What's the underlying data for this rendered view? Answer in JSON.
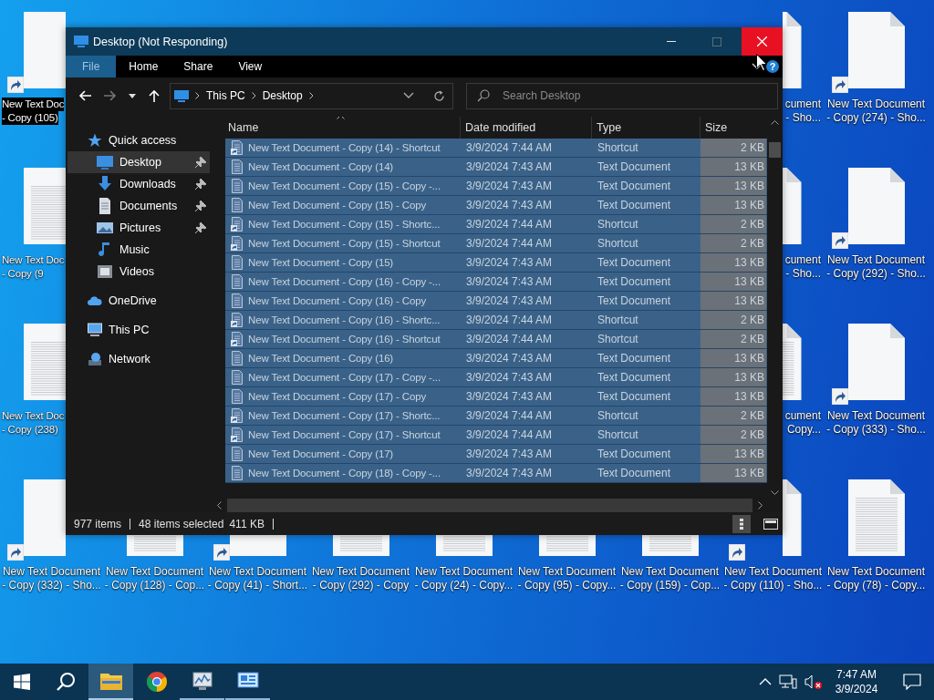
{
  "desktop": {
    "left_column": [
      {
        "kind": "shortcut",
        "selected": true,
        "label_lines": [
          "New Text Doc",
          "- Copy (105)"
        ]
      },
      {
        "kind": "document",
        "selected": false,
        "label_lines": [
          "New Text Doc",
          "- Copy (9"
        ]
      },
      {
        "kind": "document",
        "selected": false,
        "label_lines": [
          "New Text Doc",
          "- Copy (238)"
        ]
      }
    ],
    "partial_column": [
      {
        "kind": "shortcut",
        "selected": false,
        "label_lines": [
          "cument",
          "- Sho..."
        ]
      },
      {
        "kind": "shortcut",
        "selected": false,
        "label_lines": [
          "cument",
          "- Sho..."
        ]
      },
      {
        "kind": "document",
        "selected": false,
        "label_lines": [
          "cument",
          "Copy..."
        ]
      }
    ],
    "right_column": [
      {
        "kind": "shortcut",
        "selected": false,
        "label_lines": [
          "New Text Document",
          "- Copy (274) - Sho..."
        ]
      },
      {
        "kind": "shortcut",
        "selected": false,
        "label_lines": [
          "New Text Document",
          "- Copy (292) - Sho..."
        ]
      },
      {
        "kind": "shortcut",
        "selected": false,
        "label_lines": [
          "New Text Document",
          "- Copy (333) - Sho..."
        ]
      }
    ],
    "bottom_row": [
      {
        "kind": "shortcut",
        "selected": false,
        "label_lines": [
          "New Text Document",
          "- Copy (332) - Sho..."
        ]
      },
      {
        "kind": "document",
        "selected": false,
        "label_lines": [
          "New Text Document",
          "- Copy (128) - Cop..."
        ]
      },
      {
        "kind": "shortcut",
        "selected": false,
        "label_lines": [
          "New Text Document",
          "- Copy (41) - Short..."
        ]
      },
      {
        "kind": "document",
        "selected": false,
        "label_lines": [
          "New Text Document",
          "- Copy (292) - Copy"
        ]
      },
      {
        "kind": "document",
        "selected": false,
        "label_lines": [
          "New Text Document",
          "- Copy (24) - Copy..."
        ]
      },
      {
        "kind": "document",
        "selected": false,
        "label_lines": [
          "New Text Document",
          "- Copy (95) - Copy..."
        ]
      },
      {
        "kind": "document",
        "selected": false,
        "label_lines": [
          "New Text Document",
          "- Copy (159) - Cop..."
        ]
      },
      {
        "kind": "shortcut",
        "selected": false,
        "label_lines": [
          "New Text Document",
          "- Copy (110) - Sho..."
        ]
      },
      {
        "kind": "document",
        "selected": false,
        "label_lines": [
          "New Text Document",
          "- Copy (78) - Copy..."
        ]
      }
    ]
  },
  "window": {
    "title": "Desktop (Not Responding)",
    "ribbon_tabs": [
      {
        "label": "File",
        "selected": true
      },
      {
        "label": "Home",
        "selected": false
      },
      {
        "label": "Share",
        "selected": false
      },
      {
        "label": "View",
        "selected": false
      }
    ],
    "help": "?",
    "breadcrumbs": [
      "This PC",
      "Desktop"
    ],
    "search": {
      "placeholder": "Search Desktop"
    },
    "nav": [
      {
        "kind": "star",
        "label": "Quick access",
        "selected": false,
        "children": [
          {
            "kind": "desktop",
            "label": "Desktop",
            "pinned": true,
            "selected": true
          },
          {
            "kind": "downloads",
            "label": "Downloads",
            "pinned": true,
            "selected": false
          },
          {
            "kind": "documents",
            "label": "Documents",
            "pinned": true,
            "selected": false
          },
          {
            "kind": "pictures",
            "label": "Pictures",
            "pinned": true,
            "selected": false
          },
          {
            "kind": "music",
            "label": "Music",
            "pinned": false,
            "selected": false
          },
          {
            "kind": "videos",
            "label": "Videos",
            "pinned": false,
            "selected": false
          }
        ]
      },
      {
        "kind": "cloud",
        "label": "OneDrive",
        "selected": false
      },
      {
        "kind": "pc",
        "label": "This PC",
        "selected": false
      },
      {
        "kind": "network",
        "label": "Network",
        "selected": false
      }
    ],
    "columns": [
      {
        "label": "Name",
        "sorted": true
      },
      {
        "label": "Date modified",
        "sorted": false
      },
      {
        "label": "Type",
        "sorted": false
      },
      {
        "label": "Size",
        "sorted": false
      }
    ],
    "rows": [
      {
        "kind": "shortcut",
        "name": "New Text Document - Copy (14) - Shortcut",
        "date": "3/9/2024 7:44 AM",
        "type": "Shortcut",
        "size": "2 KB",
        "selected": true
      },
      {
        "kind": "document",
        "name": "New Text Document - Copy (14)",
        "date": "3/9/2024 7:43 AM",
        "type": "Text Document",
        "size": "13 KB",
        "selected": true
      },
      {
        "kind": "document",
        "name": "New Text Document - Copy (15) - Copy -...",
        "date": "3/9/2024 7:43 AM",
        "type": "Text Document",
        "size": "13 KB",
        "selected": true
      },
      {
        "kind": "document",
        "name": "New Text Document - Copy (15) - Copy",
        "date": "3/9/2024 7:43 AM",
        "type": "Text Document",
        "size": "13 KB",
        "selected": true
      },
      {
        "kind": "shortcut",
        "name": "New Text Document - Copy (15) - Shortc...",
        "date": "3/9/2024 7:44 AM",
        "type": "Shortcut",
        "size": "2 KB",
        "selected": true
      },
      {
        "kind": "shortcut",
        "name": "New Text Document - Copy (15) - Shortcut",
        "date": "3/9/2024 7:44 AM",
        "type": "Shortcut",
        "size": "2 KB",
        "selected": true
      },
      {
        "kind": "document",
        "name": "New Text Document - Copy (15)",
        "date": "3/9/2024 7:43 AM",
        "type": "Text Document",
        "size": "13 KB",
        "selected": true
      },
      {
        "kind": "document",
        "name": "New Text Document - Copy (16) - Copy -...",
        "date": "3/9/2024 7:43 AM",
        "type": "Text Document",
        "size": "13 KB",
        "selected": true
      },
      {
        "kind": "document",
        "name": "New Text Document - Copy (16) - Copy",
        "date": "3/9/2024 7:43 AM",
        "type": "Text Document",
        "size": "13 KB",
        "selected": true
      },
      {
        "kind": "shortcut",
        "name": "New Text Document - Copy (16) - Shortc...",
        "date": "3/9/2024 7:44 AM",
        "type": "Shortcut",
        "size": "2 KB",
        "selected": true
      },
      {
        "kind": "shortcut",
        "name": "New Text Document - Copy (16) - Shortcut",
        "date": "3/9/2024 7:44 AM",
        "type": "Shortcut",
        "size": "2 KB",
        "selected": true
      },
      {
        "kind": "document",
        "name": "New Text Document - Copy (16)",
        "date": "3/9/2024 7:43 AM",
        "type": "Text Document",
        "size": "13 KB",
        "selected": true
      },
      {
        "kind": "document",
        "name": "New Text Document - Copy (17) - Copy -...",
        "date": "3/9/2024 7:43 AM",
        "type": "Text Document",
        "size": "13 KB",
        "selected": true
      },
      {
        "kind": "document",
        "name": "New Text Document - Copy (17) - Copy",
        "date": "3/9/2024 7:43 AM",
        "type": "Text Document",
        "size": "13 KB",
        "selected": true
      },
      {
        "kind": "shortcut",
        "name": "New Text Document - Copy (17) - Shortc...",
        "date": "3/9/2024 7:44 AM",
        "type": "Shortcut",
        "size": "2 KB",
        "selected": true
      },
      {
        "kind": "shortcut",
        "name": "New Text Document - Copy (17) - Shortcut",
        "date": "3/9/2024 7:44 AM",
        "type": "Shortcut",
        "size": "2 KB",
        "selected": true
      },
      {
        "kind": "document",
        "name": "New Text Document - Copy (17)",
        "date": "3/9/2024 7:43 AM",
        "type": "Text Document",
        "size": "13 KB",
        "selected": true
      },
      {
        "kind": "document",
        "name": "New Text Document - Copy (18) - Copy -...",
        "date": "3/9/2024 7:43 AM",
        "type": "Text Document",
        "size": "13 KB",
        "selected": true
      }
    ],
    "status": {
      "items": "977 items",
      "selection": "48 items selected",
      "selection_size": "411 KB"
    }
  },
  "taskbar": {
    "apps": [
      {
        "kind": "explorer",
        "selected": true,
        "running": true
      },
      {
        "kind": "chrome",
        "selected": false,
        "running": false
      },
      {
        "kind": "monitor",
        "selected": false,
        "running": true
      },
      {
        "kind": "panel",
        "selected": false,
        "running": true
      }
    ],
    "volume_muted": true,
    "time": "7:47 AM",
    "date": "3/9/2024"
  }
}
